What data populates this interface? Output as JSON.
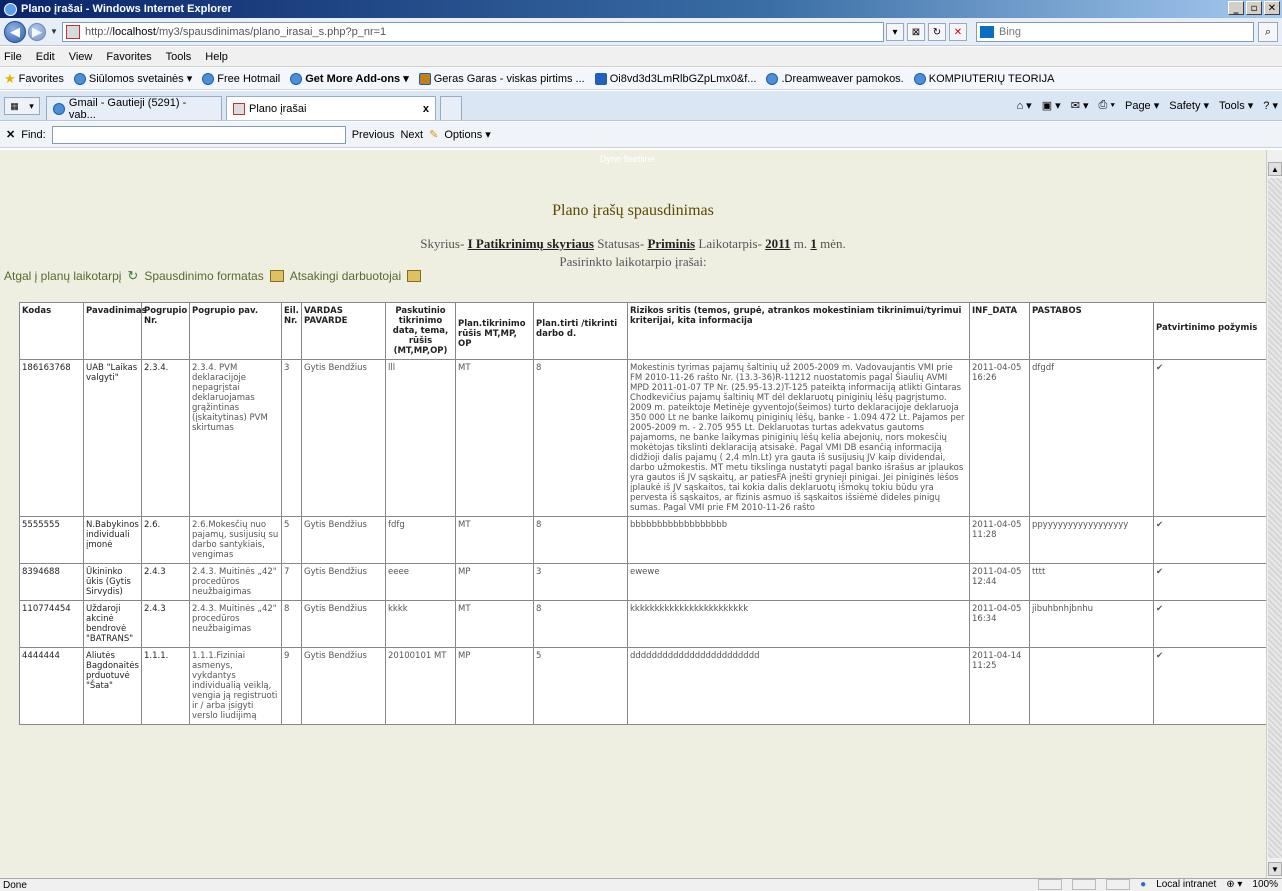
{
  "window": {
    "title": "Plano įrašai - Windows Internet Explorer"
  },
  "address": {
    "url_prefix": "http://",
    "url_host": "localhost",
    "url_path": "/my3/spausdinimas/plano_irasai_s.php?p_nr=1",
    "search_placeholder": "Bing"
  },
  "menu": [
    "File",
    "Edit",
    "View",
    "Favorites",
    "Tools",
    "Help"
  ],
  "favorites": {
    "label": "Favorites",
    "items": [
      "Siūlomos svetainės ▾",
      "Free Hotmail",
      "Get More Add-ons ▾",
      "Geras Garas - viskas pirtims ...",
      "Oi8vd3d3LmRlbGZpLmx0&f...",
      ".Dreamweaver pamokos.",
      "KOMPIUTERIŲ TEORIJA"
    ]
  },
  "tabs": {
    "tab1": "Gmail - Gautieji (5291) - vab...",
    "tab2": "Plano įrašai",
    "close": "x"
  },
  "commandbar": [
    "Page ▾",
    "Safety ▾",
    "Tools ▾"
  ],
  "findbar": {
    "label": "Find:",
    "previous": "Previous",
    "next": "Next",
    "options": "Options ▾"
  },
  "page": {
    "logo_text": "Dyno fleetline",
    "title": "Plano įrašų spausdinimas",
    "info": {
      "skyrius_label": "Skyrius-",
      "skyrius_value": "I Patikrinimų skyriaus",
      "statusas_label": "Statusas-",
      "statusas_value": "Priminis",
      "laikotarpis_label": "Laikotarpis-",
      "year": "2011",
      "m_label": "m.",
      "month": "1",
      "men_label": "mėn."
    },
    "subtitle": "Pasirinkto laikotarpio įrašai:",
    "links": {
      "back": "Atgal į planų laikotarpį",
      "format": "Spausdinimo formatas",
      "responsible": "Atsakingi darbuotojai"
    }
  },
  "table": {
    "headers": [
      "Kodas",
      "Pavadinimas",
      "Pogrupio Nr.",
      "Pogrupio pav.",
      "Eil. Nr.",
      "VARDAS PAVARDE",
      "Paskutinio tikrinimo data, tema, rūšis (MT,MP,OP)",
      "Plan.tikrinimo rūšis MT,MP, OP",
      "Plan.tirti /tikrinti darbo d.",
      "Rizikos sritis (temos, grupė, atrankos mokestiniam tikrinimui/tyrimui kriterijai, kita informacija",
      "INF_DATA",
      "PASTABOS",
      "Patvirtinimo požymis"
    ],
    "rows": [
      [
        "186163768",
        "UAB \"Laikas valgyti\"",
        "2.3.4.",
        "2.3.4. PVM deklaracijoje nepagrįstai deklaruojamas grąžintinas (įskaitytinas) PVM skirtumas",
        "3",
        "Gytis Bendžius",
        "lll",
        "MT",
        "8",
        "Mokestinis tyrimas pajamų šaltinių už 2005-2009 m. Vadovaujantis VMI prie FM 2010-11-26 rašto Nr. (13.3-36)R-11212 nuostatomis pagal Šiaulių AVMI MPD 2011-01-07 TP Nr. (25.95-13.2)T-125 pateiktą informaciją atlikti Gintaras Chodkevičius pajamų šaltinių MT dėl deklaruotų piniginių lėšų pagrįstumo. 2009 m. pateiktoje Metinėje gyventojo(šeimos) turto deklaracijoje deklaruoja 350 000 Lt ne banke laikomų piniginių lėšų, banke - 1.094 472 Lt. Pajamos per 2005-2009 m. - 2.705 955 Lt. Deklaruotas turtas adekvatus gautoms pajamoms, ne banke laikymas piniginių lėšų kelia abejonių, nors mokesčių mokėtojas tikslinti deklaraciją atsisakė. Pagal VMI DB esančią informaciją didžioji dalis pajamų ( 2,4 mln.Lt) yra gauta iš susijusių JV kaip dividendai, darbo užmokestis. MT metu tikslinga nustatyti pagal banko išrašus ar įplaukos yra gautos iš JV sąskaitų, ar patiesFA įnešti grynieji pinigai. Jei piniginės lėšos įplaukė iš JV sąskaitos, tai kokia dalis deklaruotų išmokų tokiu būdu yra pervesta iš sąskaitos, ar fizinis asmuo iš sąskaitos išsiėmė dideles pinigų sumas. Pagal VMI prie FM 2010-11-26 rašto",
        "2011-04-05 16:26",
        "dfgdf",
        "✔"
      ],
      [
        "5555555",
        "N.Babykinos individuali įmonė",
        "2.6.",
        "2.6.Mokesčių nuo pajamų, susijusių su darbo santykiais, vengimas",
        "5",
        "Gytis Bendžius",
        "fdfg",
        "MT",
        "8",
        "bbbbbbbbbbbbbbbbbb",
        "2011-04-05 11:28",
        "ppyyyyyyyyyyyyyyyyy",
        "✔"
      ],
      [
        "8394688",
        "Ūkininko ūkis (Gytis Sirvydis)",
        "2.4.3",
        "2.4.3. Muitinės „42\" procedūros neužbaigimas",
        "7",
        "Gytis Bendžius",
        "eeee",
        "MP",
        "3",
        "ewewe",
        "2011-04-05 12:44",
        "tttt",
        "✔"
      ],
      [
        "110774454",
        "Uždaroji akcinė bendrovė \"BATRANS\"",
        "2.4.3",
        "2.4.3. Muitinės „42\" procedūros neužbaigimas",
        "8",
        "Gytis Bendžius",
        "kkkk",
        "MT",
        "8",
        "kkkkkkkkkkkkkkkkkkkkkkkk",
        "2011-04-05 16:34",
        "jibuhbnhjbnhu",
        "✔"
      ],
      [
        "4444444",
        "Aliutės Bagdonaitės prduotuvė \"Šata\"",
        "1.1.1.",
        "1.1.1.Fiziniai asmenys, vykdantys individualią veiklą, vengia ją registruoti ir / arba įsigyti verslo liudijimą",
        "9",
        "Gytis Bendžius",
        "20100101 MT",
        "MP",
        "5",
        "dddddddddddddddddddddddd",
        "2011-04-14 11:25",
        "",
        "✔"
      ]
    ]
  },
  "status": {
    "left": "Done",
    "zone": "Local intranet",
    "zoom": "100%"
  }
}
